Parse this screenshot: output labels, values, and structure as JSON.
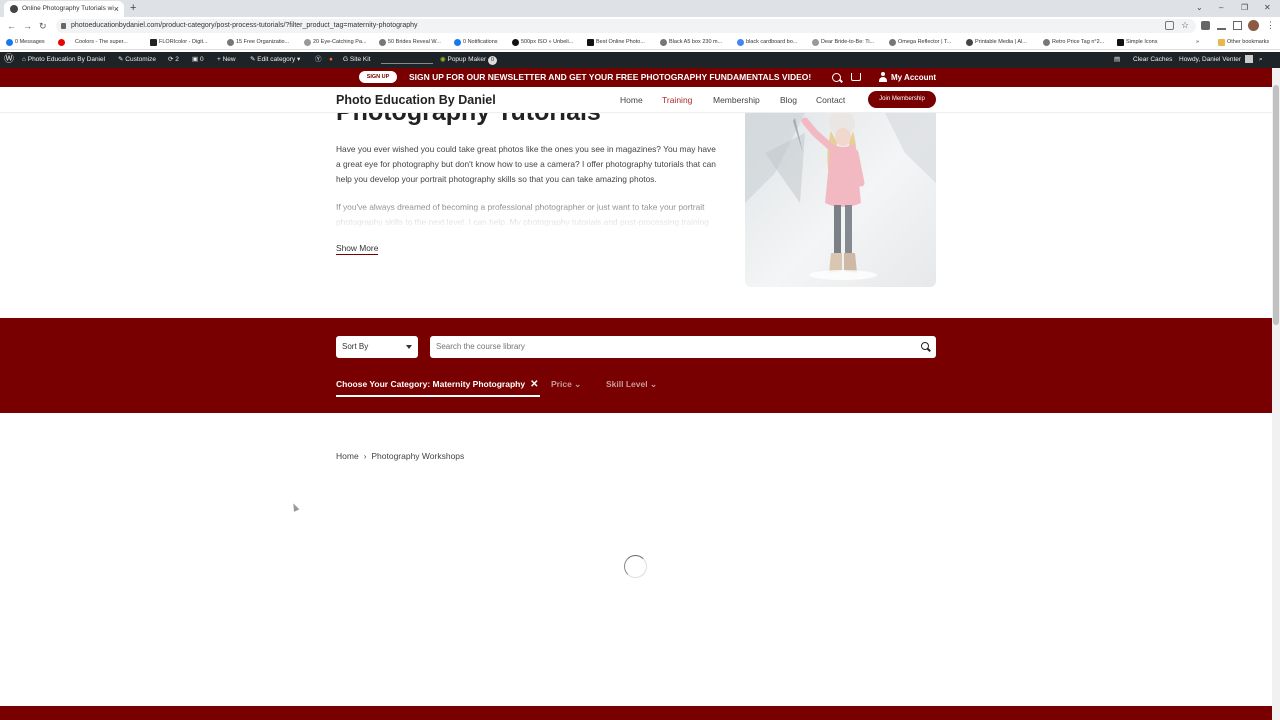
{
  "browser": {
    "tab_title": "Online Photography Tutorials wi",
    "tab_close": "×",
    "new_tab": "+",
    "url": "photoeducationbydaniel.com/product-category/post-process-tutorials/?filter_product_tag=maternity-photography",
    "back": "←",
    "forward": "→",
    "reload": "↻",
    "window_minimize": "–",
    "window_restore": "❐",
    "window_close": "✕",
    "bookmarks": [
      "0 Messages",
      "Coolors - The super...",
      "FLORIcolor - Digit...",
      "15 Free Organizatio...",
      "20 Eye-Catching Pa...",
      "50 Brides Reveal W...",
      "0 Notifications",
      "500px ISO » Unbeli...",
      "Best Online Photo...",
      "Black A5 box 230 m...",
      "black cardboard bo...",
      "Dear Bride-to-Be: Ti...",
      "Omega Reflector | T...",
      "Printable Media | Al...",
      "Retro Price Tag n°2...",
      "Simple Icons"
    ],
    "bookmarks_more": "»",
    "other_bookmarks": "Other bookmarks"
  },
  "admin_bar": {
    "site_name": "Photo Education By Daniel",
    "customize": "Customize",
    "updates": "2",
    "comments": "0",
    "new": "New",
    "edit_category": "Edit category",
    "site_kit": "Site Kit",
    "popup_maker": "Popup Maker",
    "popup_count": "0",
    "clear_caches": "Clear Caches",
    "howdy": "Howdy, Daniel Venter"
  },
  "announcement": {
    "signup_button": "SIGN UP",
    "text": "SIGN UP FOR OUR NEWSLETTER AND GET YOUR FREE PHOTOGRAPHY FUNDAMENTALS VIDEO!",
    "account": "My Account"
  },
  "header": {
    "site_title": "Photo Education By Daniel",
    "nav": [
      "Home",
      "Training",
      "Membership",
      "Blog",
      "Contact"
    ],
    "join_button": "Join Membership"
  },
  "hero": {
    "title": "Photography Tutorials",
    "paragraph1": "Have you ever wished you could take great photos like the ones you see in magazines? You may have a great eye for photography but don't know how to use a camera? I offer photography tutorials that can help you develop your portrait photography skills so that you can take amazing photos.",
    "paragraph2": "If you've always dreamed of becoming a professional photographer or just want to take your portrait photography skills to the next level, I can help. My photography tutorials and post-processing training",
    "show_more": "Show More"
  },
  "filters": {
    "sort_label": "Sort By",
    "search_placeholder": "Search the course library",
    "category_tab": "Choose Your Category: Maternity Photography",
    "category_clear": "✕",
    "price_tab": "Price",
    "skill_tab": "Skill Level",
    "chevron": "⌄"
  },
  "breadcrumb": {
    "home": "Home",
    "separator": "›",
    "current": "Photography Workshops"
  },
  "colors": {
    "brand": "#780000",
    "admin_bar": "#1d2327"
  }
}
